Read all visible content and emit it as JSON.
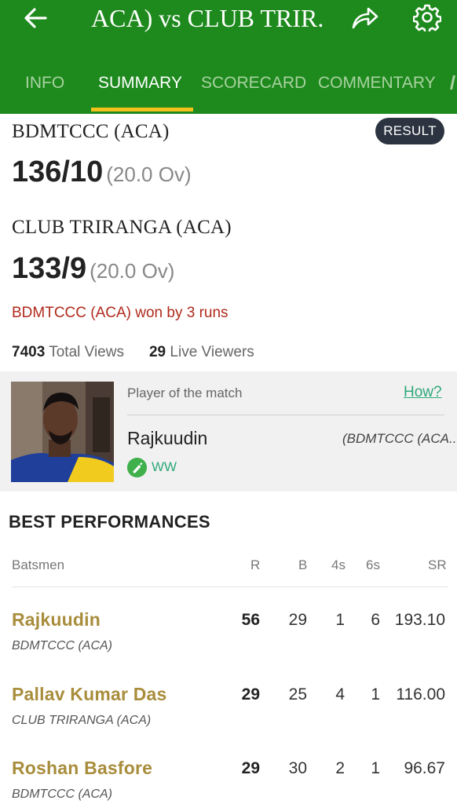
{
  "header": {
    "title": "ACA) vs CLUB TRIR.",
    "back_icon": "arrow-left-icon",
    "share_icon": "share-icon",
    "settings_icon": "gear-icon",
    "colors": {
      "bar": "#1e8a1e",
      "indicator": "#f5c21b"
    }
  },
  "tabs": [
    {
      "label": "INFO"
    },
    {
      "label": "SUMMARY"
    },
    {
      "label": "SCORECARD"
    },
    {
      "label": "COMMENTARY"
    }
  ],
  "match": {
    "status_badge": "RESULT",
    "team1": {
      "name": "BDMTCCC (ACA)",
      "score": "136/10",
      "overs": "(20.0 Ov)"
    },
    "team2": {
      "name": "CLUB TRIRANGA (ACA)",
      "score": "133/9",
      "overs": "(20.0 Ov)"
    },
    "result": "BDMTCCC (ACA) won by 3 runs",
    "total_views": "7403",
    "total_views_label": "Total Views",
    "live_viewers": "29",
    "live_viewers_label": "Live Viewers"
  },
  "player_of_match": {
    "label": "Player of the match",
    "how_link": "How?",
    "name": "Rajkuudin",
    "team": "(BDMTCCC (ACA..",
    "role": "WW",
    "role_icon": "bat-icon"
  },
  "best_performances": {
    "title": "BEST PERFORMANCES",
    "columns": [
      "Batsmen",
      "R",
      "B",
      "4s",
      "6s",
      "SR"
    ],
    "rows": [
      {
        "name": "Rajkuudin",
        "team": "BDMTCCC (ACA)",
        "r": "56",
        "b": "29",
        "fours": "1",
        "sixes": "6",
        "sr": "193.10"
      },
      {
        "name": "Pallav Kumar Das",
        "team": "CLUB TRIRANGA (ACA)",
        "r": "29",
        "b": "25",
        "fours": "4",
        "sixes": "1",
        "sr": "116.00"
      },
      {
        "name": "Roshan Basfore",
        "team": "BDMTCCC (ACA)",
        "r": "29",
        "b": "30",
        "fours": "2",
        "sixes": "1",
        "sr": "96.67"
      }
    ]
  }
}
